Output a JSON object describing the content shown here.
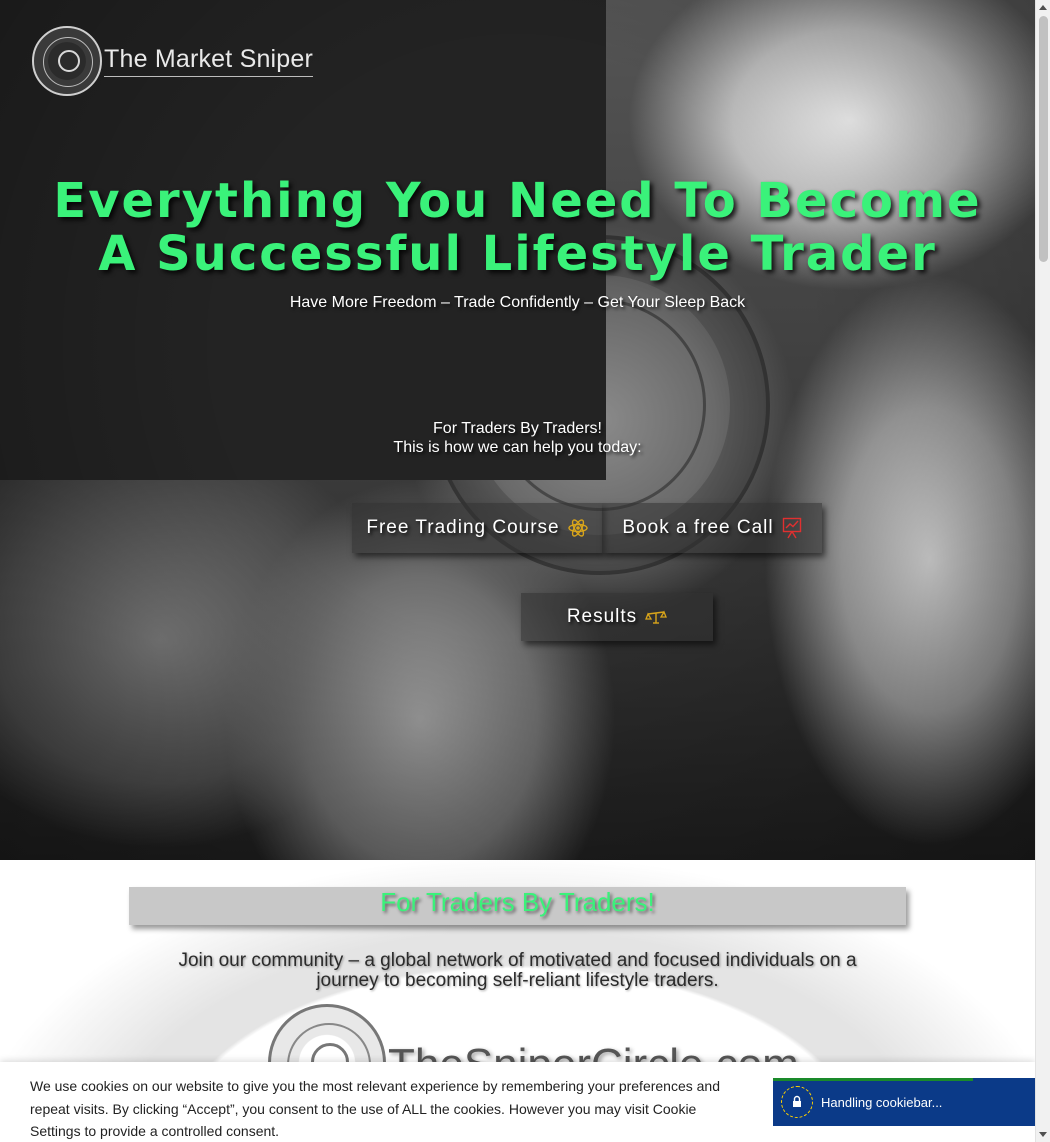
{
  "brand": {
    "logo_text": "The Market Sniper"
  },
  "hero": {
    "title": "Everything You Need To Become A Successful Lifestyle Trader",
    "subtitle": "Have More Freedom – Trade Confidently – Get Your Sleep Back",
    "lead_line1": "For Traders By Traders!",
    "lead_line2": "This is how we can help you today:",
    "buttons": {
      "course": {
        "label": "Free Trading Course",
        "icon": "atom-icon"
      },
      "call": {
        "label": "Book a free Call",
        "icon": "presentation-chart-icon"
      },
      "results": {
        "label": "Results",
        "icon": "balance-scale-icon"
      }
    }
  },
  "community": {
    "banner": "For Traders By Traders!",
    "text": "Join our community – a global network of motivated and focused individuals on a journey to becoming self-reliant lifestyle traders.",
    "logo_text": "TheSniperCircle.com"
  },
  "cookie": {
    "message": "We use cookies on our website to give you the most relevant experience by remembering your preferences and repeat visits. By clicking “Accept”, you consent to the use of ALL the cookies. However you may visit Cookie Settings to provide a controlled consent.",
    "widget_text": "Handling cookiebar..."
  },
  "colors": {
    "accent_green": "#3af27a",
    "icon_gold": "#d9a51a",
    "icon_red": "#e03030",
    "cookie_widget_blue": "#0b3a88"
  }
}
